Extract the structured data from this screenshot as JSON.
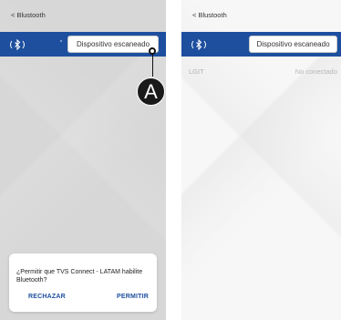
{
  "left_screen": {
    "back_label": "< Blustooth",
    "scan_button_label": "Dispositivo escaneado",
    "callout_label": "A",
    "dialog": {
      "message": "¿Permitir que TVS Connect - LATAM habilite Bluetooth?",
      "reject_label": "RECHAZAR",
      "allow_label": "PERMITIR"
    }
  },
  "right_screen": {
    "back_label": "< Blustooth",
    "scan_button_label": "Dispositivo escaneado",
    "devices": [
      {
        "name": "LGIT",
        "status": "No conectado"
      }
    ]
  },
  "colors": {
    "header_blue": "#1d4f9e",
    "dim_background": "#d7d7d7",
    "light_background": "#f7f7f7"
  }
}
